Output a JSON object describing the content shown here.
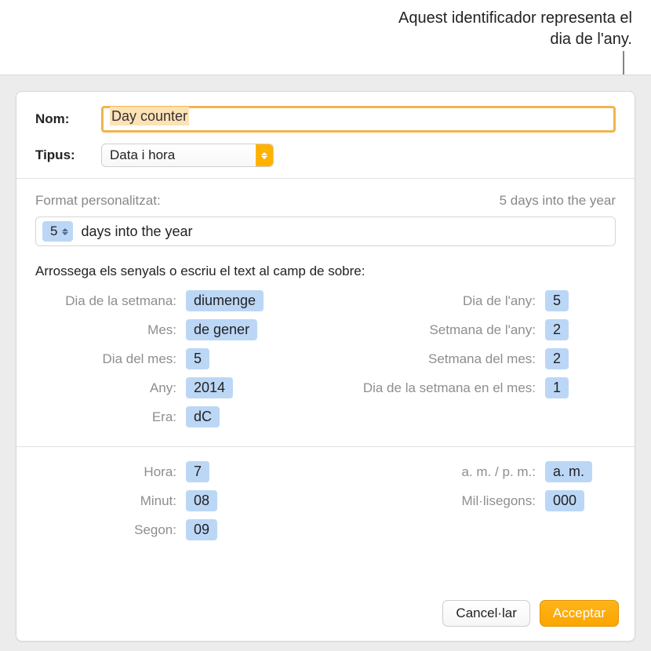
{
  "annotation": "Aquest identificador representa el dia de l'any.",
  "labels": {
    "name": "Nom:",
    "type": "Tipus:",
    "format_header": "Format personalitzat:",
    "format_preview": "5 days into the year",
    "format_token_value": "5",
    "format_text_after": "days into the year",
    "instruction": "Arrossega els senyals o escriu el text al camp de sobre:"
  },
  "name_value": "Day counter",
  "type_value": "Data i hora",
  "tokens_left": [
    {
      "label": "Dia de la setmana:",
      "value": "diumenge"
    },
    {
      "label": "Mes:",
      "value": "de gener"
    },
    {
      "label": "Dia del mes:",
      "value": "5"
    },
    {
      "label": "Any:",
      "value": "2014"
    },
    {
      "label": "Era:",
      "value": "dC"
    }
  ],
  "tokens_right": [
    {
      "label": "Dia de l'any:",
      "value": "5"
    },
    {
      "label": "Setmana de l'any:",
      "value": "2"
    },
    {
      "label": "Setmana del mes:",
      "value": "2"
    },
    {
      "label": "Dia de la setmana en el mes:",
      "value": "1"
    }
  ],
  "time_left": [
    {
      "label": "Hora:",
      "value": "7"
    },
    {
      "label": "Minut:",
      "value": "08"
    },
    {
      "label": "Segon:",
      "value": "09"
    }
  ],
  "time_right": [
    {
      "label": "a. m. / p. m.:",
      "value": "a. m."
    },
    {
      "label": "Mil·lisegons:",
      "value": "000"
    }
  ],
  "buttons": {
    "cancel": "Cancel·lar",
    "accept": "Acceptar"
  }
}
